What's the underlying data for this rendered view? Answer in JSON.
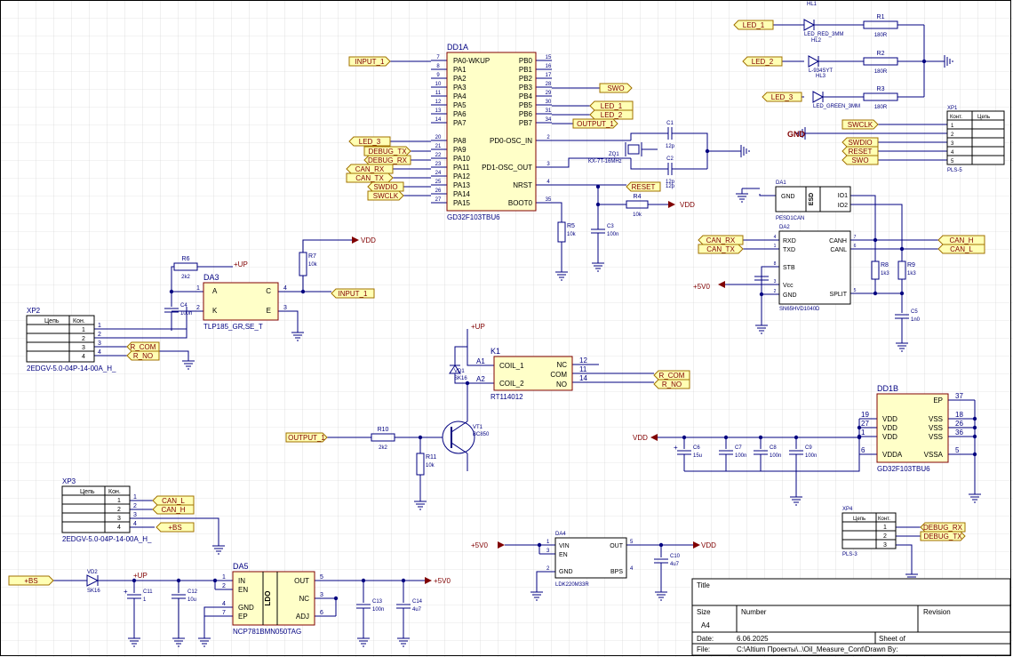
{
  "title_block": {
    "title_label": "Title",
    "size_label": "Size",
    "size_value": "A4",
    "number_label": "Number",
    "revision_label": "Revision",
    "date_label": "Date:",
    "date_value": "6.06.2025",
    "sheet_label": "Sheet   of",
    "file_label": "File:",
    "file_value": "C:\\Altium Проекты\\..\\Oil_Measure_Cont\\Drawn By:"
  },
  "colors": {
    "wire": "#000080",
    "grid": "#c8c8c8",
    "port_fill": "#ffffb4",
    "port_stroke": "#a07000",
    "comp_fill": "#ffffc8",
    "comp_stroke": "#800000",
    "text": "#000080"
  },
  "dd1a": {
    "ref": "DD1A",
    "part": "GD32F103TBU6",
    "left_pins": [
      "PA0-WKUP",
      "PA1",
      "PA2",
      "PA3",
      "PA4",
      "PA5",
      "PA6",
      "PA7",
      "PA8",
      "PA9",
      "PA10",
      "PA11",
      "PA12",
      "PA13",
      "PA14",
      "PA15"
    ],
    "left_nums": [
      "7",
      "8",
      "9",
      "10",
      "11",
      "12",
      "13",
      "14",
      "20",
      "21",
      "22",
      "23",
      "24",
      "25",
      "26",
      "27"
    ],
    "right_pins": [
      "PB0",
      "PB1",
      "PB2",
      "PB3",
      "PB4",
      "PB5",
      "PB6",
      "PB7",
      "PD0-OSC_IN",
      "PD1-OSC_OUT",
      "NRST",
      "BOOT0"
    ],
    "right_nums": [
      "15",
      "16",
      "17",
      "28",
      "29",
      "30",
      "31",
      "34",
      "2",
      "3",
      "4",
      "35"
    ],
    "ports_left": [
      "INPUT_1",
      "LED_3",
      "DEBUG_TX",
      "DEBUG_RX",
      "CAN_RX",
      "CAN_TX",
      "SWDIO",
      "SWCLK"
    ],
    "ports_right": [
      "SWO",
      "LED_1",
      "LED_2",
      "OUTPUT_1",
      "RESET"
    ]
  },
  "dd1b": {
    "ref": "DD1B",
    "part": "GD32F103TBU6",
    "left_pins": [
      "VDD",
      "VDD",
      "VDD",
      "VDDA"
    ],
    "left_nums": [
      "19",
      "27",
      "1",
      "6"
    ],
    "right_pins": [
      "EP",
      "VSS",
      "VSS",
      "VSS",
      "VSSA"
    ],
    "right_nums": [
      "37",
      "18",
      "26",
      "36",
      "5"
    ]
  },
  "leds": {
    "items": [
      {
        "port": "LED_1",
        "ref": "HL1",
        "part": "LED_RED_3MM",
        "res": "R1",
        "val": "180R"
      },
      {
        "port": "LED_2",
        "ref": "HL2",
        "part": "L-934SYT",
        "res": "R2",
        "val": "180R"
      },
      {
        "port": "LED_3",
        "ref": "HL3",
        "part": "LED_GREEN_3MM",
        "res": "R3",
        "val": "180R"
      }
    ]
  },
  "crystal": {
    "ref": "ZQ1",
    "part": "KX-7T-16MHz",
    "c1": "C1",
    "c1v": "12p",
    "c2": "C2",
    "c2v": "12p"
  },
  "boot": {
    "r5": "R5",
    "r5v": "10k",
    "c3": "C3",
    "c3v": "100n",
    "r4": "R4",
    "r4v": "10k",
    "vdd": "VDD"
  },
  "xp1": {
    "ref": "XP1",
    "part": "PLS-5",
    "head_kont": "Конт.",
    "head_chain": "Цепь",
    "rows": [
      "1",
      "2",
      "3",
      "4",
      "5"
    ],
    "ports": [
      "SWCLK",
      "SWDIO",
      "RESET",
      "SWO"
    ],
    "gnd": "GND"
  },
  "da1": {
    "ref": "DA1",
    "part": "PESD1CAN",
    "pins_l": [
      "GND"
    ],
    "pins_r": [
      "IO1",
      "IO2"
    ],
    "mid": "ESD",
    "nums": [
      "1",
      "2",
      "3"
    ]
  },
  "da2": {
    "ref": "DA2",
    "part": "SN65HVD1040D",
    "left_pins": [
      "RXD",
      "TXD",
      "STB",
      "Vcc",
      "GND"
    ],
    "left_nums": [
      "4",
      "1",
      "8",
      "3",
      "2"
    ],
    "right_pins": [
      "CANH",
      "CANL",
      "SPLIT"
    ],
    "right_nums": [
      "7",
      "6",
      "5"
    ],
    "ports_left": [
      "CAN_RX",
      "CAN_TX"
    ],
    "ports_right": [
      "CAN_H",
      "CAN_L"
    ],
    "vcc": "+5V0",
    "r8": "R8",
    "r8v": "1k3",
    "r9": "R9",
    "r9v": "1k3",
    "c5": "C5",
    "c5v": "1n0"
  },
  "da3": {
    "ref": "DA3",
    "part": "TLP185_GR,SE_T",
    "pins": [
      "A",
      "K",
      "C",
      "E"
    ],
    "nums": [
      "1",
      "2",
      "4",
      "3"
    ],
    "r6": "R6",
    "r6v": "2k2",
    "r7": "R7",
    "r7v": "10k",
    "c4": "C4",
    "c4v": "100n",
    "up": "+UP",
    "vdd": "VDD",
    "port": "INPUT_1"
  },
  "xp2": {
    "ref": "XP2",
    "part": "2EDGV-5.0-04P-14-00A_H_",
    "head_chain": "Цепь",
    "head_kont": "Кон.",
    "rows": [
      "1",
      "2",
      "3",
      "4"
    ],
    "pin_nums": [
      "1",
      "2",
      "3",
      "4"
    ],
    "ports": [
      "R_COM",
      "R_NO"
    ]
  },
  "k1": {
    "ref": "K1",
    "part": "RT114012",
    "pins_l": [
      "COIL_1",
      "COIL_2"
    ],
    "nums_l": [
      "A1",
      "A2"
    ],
    "pins_r": [
      "NC",
      "COM",
      "NO"
    ],
    "nums_r": [
      "12",
      "11",
      "14"
    ],
    "ports": [
      "R_COM",
      "R_NO"
    ],
    "up": "+UP",
    "vd": "VD1",
    "vdpart": "SK16"
  },
  "vt1": {
    "ref": "VT1",
    "part": "BC850",
    "r10": "R10",
    "r10v": "2k2",
    "r11": "R11",
    "r11v": "10k",
    "port": "OUTPUT_1"
  },
  "decoupling": {
    "vdd": "VDD",
    "caps": [
      {
        "ref": "C6",
        "val": "15u"
      },
      {
        "ref": "C7",
        "val": "100n"
      },
      {
        "ref": "C8",
        "val": "100n"
      },
      {
        "ref": "C9",
        "val": "100n"
      }
    ]
  },
  "xp3": {
    "ref": "XP3",
    "part": "2EDGV-5.0-04P-14-00A_H_",
    "head_chain": "Цепь",
    "head_kont": "Кон.",
    "rows": [
      "1",
      "2",
      "3",
      "4"
    ],
    "pin_nums": [
      "1",
      "2",
      "3",
      "4"
    ],
    "ports": [
      "CAN_L",
      "CAN_H",
      "+BS"
    ]
  },
  "xp4": {
    "ref": "XP4",
    "part": "PLS-3",
    "head_chain": "Цепь",
    "head_kont": "Конт.",
    "rows": [
      "1",
      "2",
      "3"
    ],
    "ports": [
      "DEBUG_RX",
      "DEBUG_TX"
    ]
  },
  "da4": {
    "ref": "DA4",
    "part": "LDK220M33R",
    "pins_l": [
      "VIN",
      "EN",
      "GND"
    ],
    "nums_l": [
      "1",
      "3",
      "2"
    ],
    "pins_r": [
      "OUT",
      "BPS"
    ],
    "nums_r": [
      "5",
      "4"
    ],
    "in": "+5V0",
    "out": "VDD",
    "c10": "C10",
    "c10v": "4u7"
  },
  "da5": {
    "ref": "DA5",
    "part": "NCP781BMN050TAG",
    "pins_l": [
      "IN",
      "EN",
      "GND",
      "EP"
    ],
    "nums_l": [
      "1",
      "2",
      "4",
      "7"
    ],
    "pins_r": [
      "OUT",
      "NC",
      "ADJ"
    ],
    "nums_r": [
      "5",
      "3",
      "6"
    ],
    "mid": "LDO",
    "bs": "+BS",
    "vd": "VD2",
    "vdpart": "SK16",
    "up": "+UP",
    "out": "+5V0",
    "caps": [
      {
        "ref": "C11",
        "val": "1"
      },
      {
        "ref": "C12",
        "val": "10u"
      },
      {
        "ref": "C13",
        "val": "100n"
      },
      {
        "ref": "C14",
        "val": "4u7"
      }
    ]
  }
}
